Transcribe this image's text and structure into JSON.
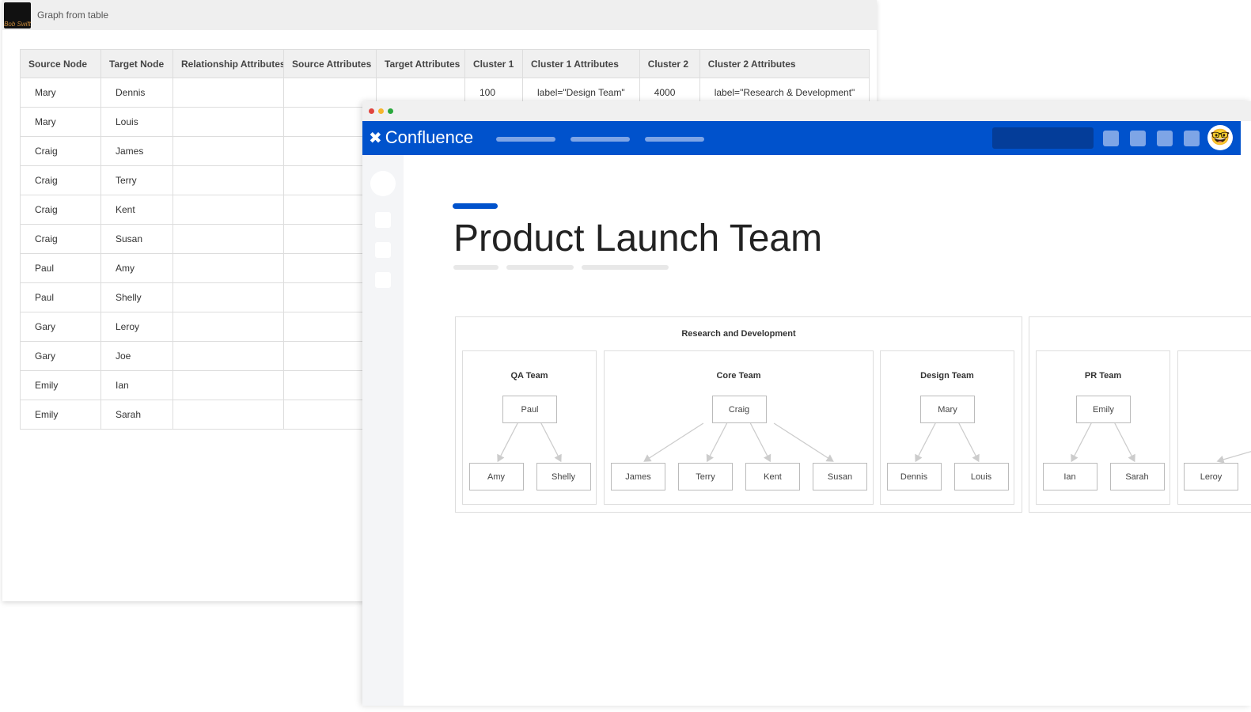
{
  "left_window": {
    "title": "Graph from table",
    "logo_text": "BobSwift",
    "columns": [
      "Source Node",
      "Target Node",
      "Relationship Attributes",
      "Source Attributes",
      "Target Attributes",
      "Cluster 1",
      "Cluster 1 Attributes",
      "Cluster 2",
      "Cluster 2 Attributes"
    ],
    "rows": [
      [
        "Mary",
        "Dennis",
        "",
        "",
        "",
        "100",
        "label=\"Design Team\"",
        "4000",
        "label=\"Research & Development\""
      ],
      [
        "Mary",
        "Louis",
        "",
        "",
        "",
        "",
        "",
        "",
        ""
      ],
      [
        "Craig",
        "James",
        "",
        "",
        "",
        "",
        "",
        "",
        ""
      ],
      [
        "Craig",
        "Terry",
        "",
        "",
        "",
        "",
        "",
        "",
        ""
      ],
      [
        "Craig",
        "Kent",
        "",
        "",
        "",
        "",
        "",
        "",
        ""
      ],
      [
        "Craig",
        "Susan",
        "",
        "",
        "",
        "",
        "",
        "",
        ""
      ],
      [
        "Paul",
        "Amy",
        "",
        "",
        "",
        "",
        "",
        "",
        ""
      ],
      [
        "Paul",
        "Shelly",
        "",
        "",
        "",
        "",
        "",
        "",
        ""
      ],
      [
        "Gary",
        "Leroy",
        "",
        "",
        "",
        "",
        "",
        "",
        ""
      ],
      [
        "Gary",
        "Joe",
        "",
        "",
        "",
        "",
        "",
        "",
        ""
      ],
      [
        "Emily",
        "Ian",
        "",
        "",
        "",
        "",
        "",
        "",
        ""
      ],
      [
        "Emily",
        "Sarah",
        "",
        "",
        "",
        "",
        "",
        "",
        ""
      ]
    ]
  },
  "confluence": {
    "brand": "Confluence",
    "page_title": "Product Launch Team",
    "accent": "#0052cc",
    "diagram": {
      "cluster_label": "Research and Development",
      "teams": [
        {
          "name": "QA Team",
          "root": "Paul",
          "children": [
            "Amy",
            "Shelly"
          ]
        },
        {
          "name": "Core Team",
          "root": "Craig",
          "children": [
            "James",
            "Terry",
            "Kent",
            "Susan"
          ]
        },
        {
          "name": "Design  Team",
          "root": "Mary",
          "children": [
            "Dennis",
            "Louis"
          ]
        },
        {
          "name": "PR Team",
          "root": "Emily",
          "children": [
            "Ian",
            "Sarah"
          ]
        },
        {
          "name": "",
          "root": "",
          "children": [
            "Leroy"
          ]
        }
      ]
    }
  }
}
